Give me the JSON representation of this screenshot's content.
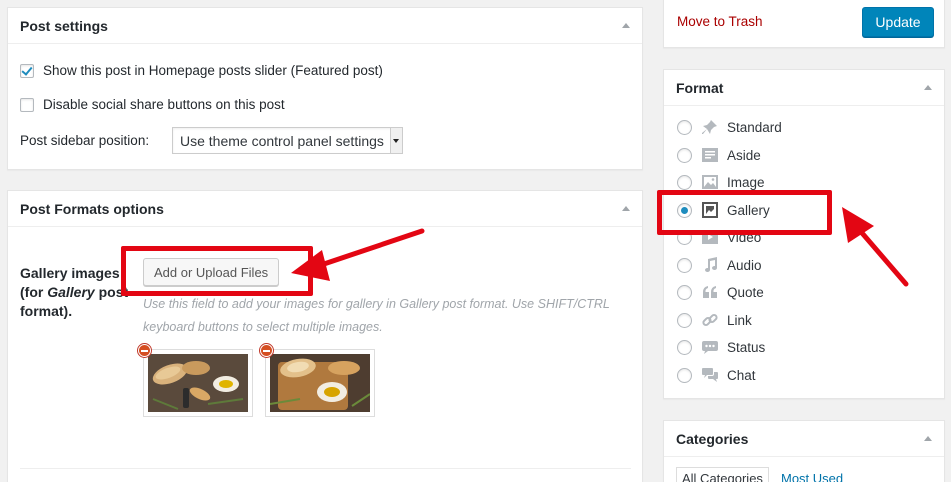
{
  "post_settings": {
    "title": "Post settings",
    "featured_label": "Show this post in Homepage posts slider (Featured post)",
    "featured_checked": true,
    "disable_share_label": "Disable social share buttons on this post",
    "disable_share_checked": false,
    "sidebar_label": "Post sidebar position:",
    "sidebar_value": "Use theme control panel settings"
  },
  "post_formats": {
    "title": "Post Formats options",
    "gallery_label_line1": "Gallery images",
    "gallery_label_line2_prefix": "(for ",
    "gallery_label_line2_em": "Gallery",
    "gallery_label_line2_suffix": " post",
    "gallery_label_line3": "format).",
    "upload_button": "Add or Upload Files",
    "help_line1": "Use this field to add your images for gallery in Gallery post format. Use SHIFT/CTRL",
    "help_line2": "keyboard buttons to select multiple images."
  },
  "publish": {
    "trash_label": "Move to Trash",
    "update_label": "Update"
  },
  "format": {
    "title": "Format",
    "selected": "Gallery",
    "options": [
      {
        "label": "Standard",
        "icon": "pin-icon"
      },
      {
        "label": "Aside",
        "icon": "aside-icon"
      },
      {
        "label": "Image",
        "icon": "image-icon"
      },
      {
        "label": "Gallery",
        "icon": "gallery-icon"
      },
      {
        "label": "Video",
        "icon": "video-icon"
      },
      {
        "label": "Audio",
        "icon": "audio-icon"
      },
      {
        "label": "Quote",
        "icon": "quote-icon"
      },
      {
        "label": "Link",
        "icon": "link-icon"
      },
      {
        "label": "Status",
        "icon": "status-icon"
      },
      {
        "label": "Chat",
        "icon": "chat-icon"
      }
    ]
  },
  "categories": {
    "title": "Categories",
    "tab_all": "All Categories",
    "tab_most_used": "Most Used"
  },
  "colors": {
    "accent": "#0085ba",
    "link": "#0073aa",
    "trash": "#a00",
    "annotation": "#e30613"
  }
}
